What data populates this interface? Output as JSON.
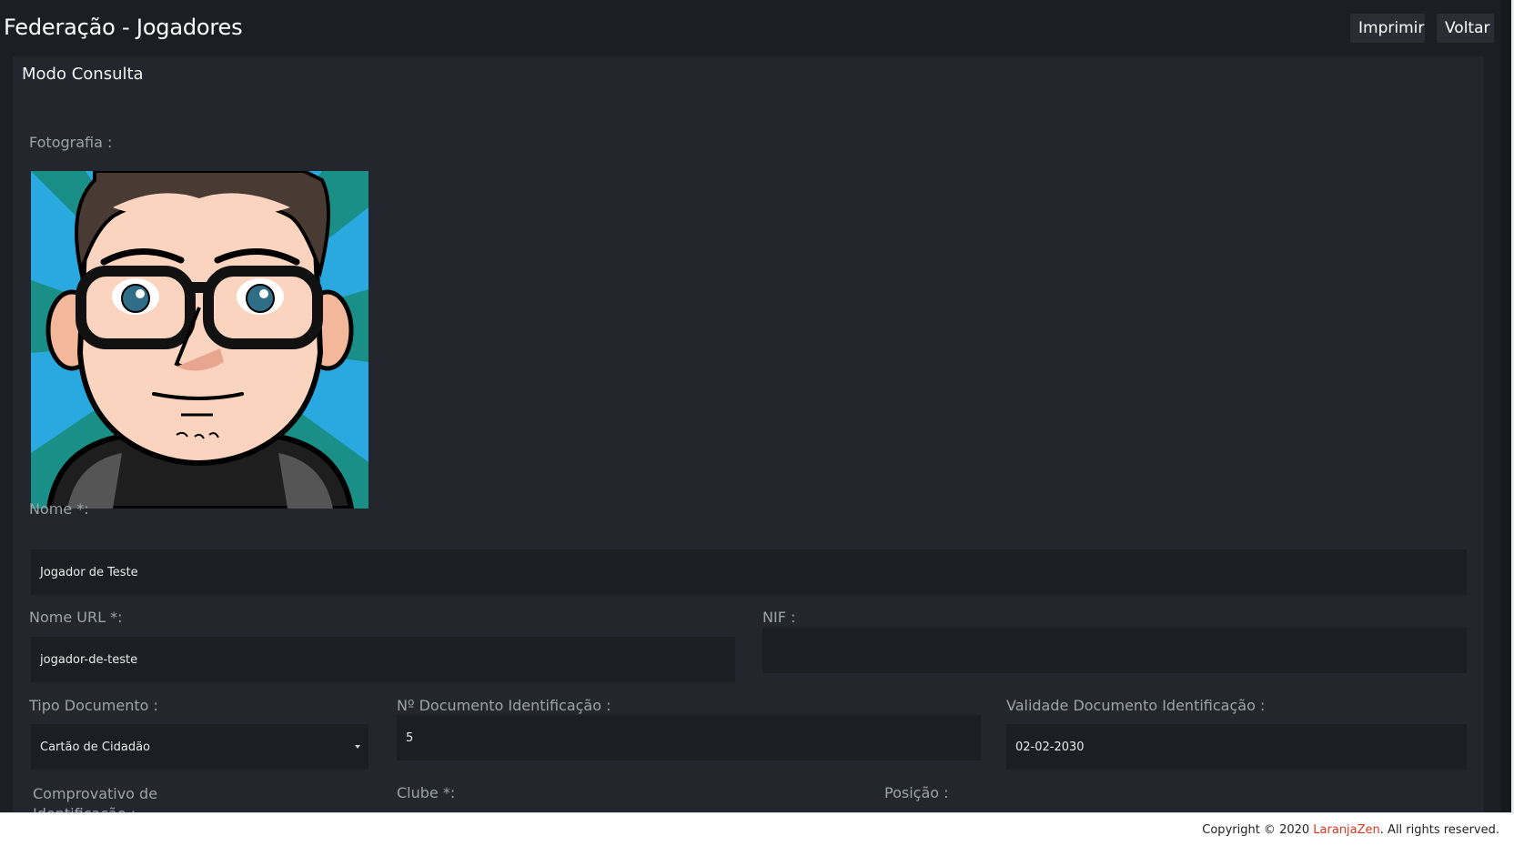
{
  "header": {
    "title": "Federação - Jogadores",
    "print_label": "Imprimir",
    "back_label": "Voltar"
  },
  "panel": {
    "title": "Modo Consulta"
  },
  "form": {
    "photo_label": "Fotografia :",
    "nome_label": "Nome *:",
    "nome_value": "Jogador de Teste",
    "nome_url_label": "Nome URL *:",
    "nome_url_value": "jogador-de-teste",
    "nif_label": "NIF :",
    "nif_value": "",
    "tipo_doc_label": "Tipo Documento :",
    "tipo_doc_value": "Cartão de Cidadão",
    "num_doc_label": "Nº Documento Identificação :",
    "num_doc_value": "5",
    "validade_label": "Validade Documento Identificação :",
    "validade_value": "02-02-2030",
    "comprovativo_label_line1": "Comprovativo de",
    "comprovativo_label_line2": "Identificação :",
    "clube_label": "Clube *:",
    "posicao_label": "Posição :"
  },
  "footer": {
    "prefix": "Copyright © 2020 ",
    "brand": "LaranjaZen",
    "suffix": ". All rights reserved."
  },
  "colors": {
    "background": "#1b1e23",
    "panel": "#23272d",
    "brand": "#d9381e"
  },
  "icons": {
    "select_caret": "caret-down-icon"
  }
}
